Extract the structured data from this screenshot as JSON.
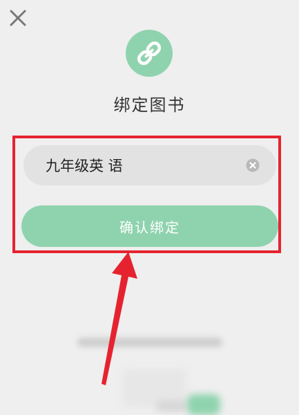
{
  "dialog": {
    "title": "绑定图书",
    "close_icon": "close-icon",
    "link_icon": "link-icon"
  },
  "form": {
    "book_input_value": "九年级英 语",
    "clear_icon": "clear-circle-icon",
    "confirm_label": "确认绑定"
  },
  "colors": {
    "background": "#efefef",
    "accent_green": "#8fd3ae",
    "highlight_red": "#e5232f",
    "input_bg": "#e2e2e2"
  }
}
